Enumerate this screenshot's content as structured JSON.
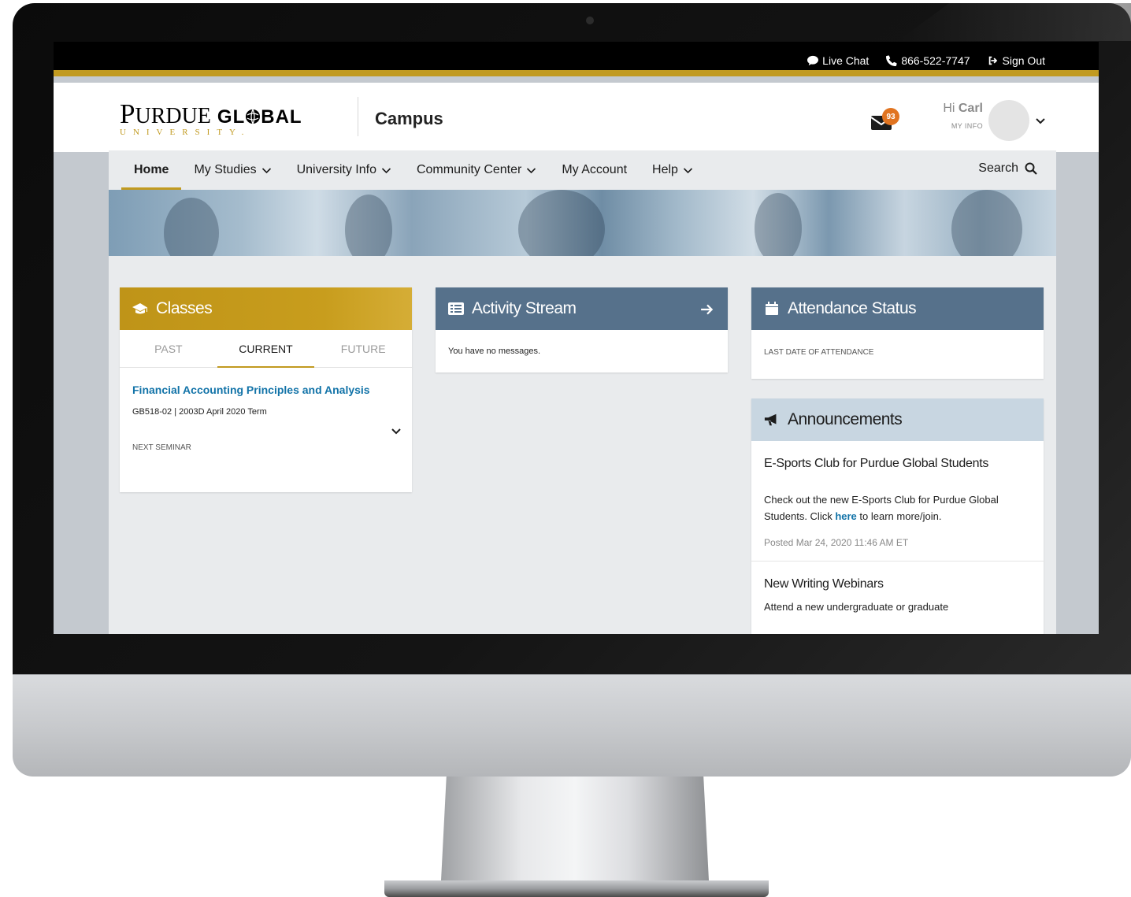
{
  "utility": {
    "live_chat": "Live Chat",
    "phone": "866-522-7747",
    "sign_out": "Sign Out"
  },
  "header": {
    "logo_purdue_first": "P",
    "logo_purdue_rest": "URDUE",
    "logo_global": "GL●BAL",
    "logo_university": "UNIVERSITY.",
    "campus": "Campus",
    "mail_count": "93",
    "greeting_hi": "Hi",
    "greeting_name": "Carl",
    "my_info": "MY INFO"
  },
  "nav": {
    "items": [
      {
        "label": "Home",
        "active": true
      },
      {
        "label": "My Studies",
        "dropdown": true
      },
      {
        "label": "University Info",
        "dropdown": true
      },
      {
        "label": "Community Center",
        "dropdown": true
      },
      {
        "label": "My Account"
      },
      {
        "label": "Help",
        "dropdown": true
      }
    ],
    "search": "Search"
  },
  "classes": {
    "title": "Classes",
    "tabs": [
      "PAST",
      "CURRENT",
      "FUTURE"
    ],
    "active_tab": "CURRENT",
    "course_title": "Financial Accounting Principles and Analysis",
    "course_meta": "GB518-02 | 2003D April 2020 Term",
    "next_seminar": "NEXT SEMINAR"
  },
  "activity": {
    "title": "Activity Stream",
    "empty": "You have no messages."
  },
  "attendance": {
    "title": "Attendance Status",
    "last_date_label": "LAST DATE OF ATTENDANCE"
  },
  "announcements": {
    "title": "Announcements",
    "items": [
      {
        "title": "E-Sports Club for Purdue Global Students",
        "body_before": "Check out the new E-Sports Club for Purdue Global Students. Click ",
        "link": "here",
        "body_after": " to learn more/join.",
        "posted": "Posted Mar 24, 2020 11:46 AM ET"
      },
      {
        "title": "New Writing Webinars",
        "body": "Attend a new undergraduate or graduate"
      }
    ]
  },
  "colors": {
    "brand_gold": "#c19a20",
    "card_slate": "#56718b",
    "link_blue": "#1273a8",
    "badge_orange": "#e17420"
  }
}
